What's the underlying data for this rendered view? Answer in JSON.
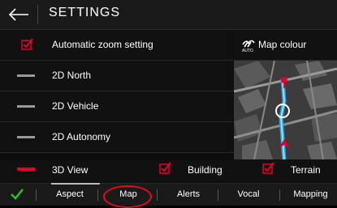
{
  "header": {
    "title": "SETTINGS",
    "back_icon": "back-arrow-icon"
  },
  "rows": [
    {
      "label": "Automatic zoom setting",
      "checked": true
    },
    {
      "label": "2D North",
      "selected": false
    },
    {
      "label": "2D Vehicle",
      "selected": false
    },
    {
      "label": "2D Autonomy",
      "selected": false
    }
  ],
  "map_colour": {
    "label": "Map colour",
    "icon": "auto-map-colour-icon"
  },
  "view_3d": {
    "label": "3D View",
    "selected": true
  },
  "building": {
    "label": "Building",
    "checked": true
  },
  "terrain": {
    "label": "Terrain",
    "checked": true
  },
  "tabs": [
    "Aspect",
    "Map",
    "Alerts",
    "Vocal",
    "Mapping"
  ],
  "active_tab": "Aspect",
  "confirm_icon": "checkmark-icon",
  "colors": {
    "accent": "#e5002b",
    "confirm": "#2ec21f",
    "route": "#27a8e0"
  }
}
